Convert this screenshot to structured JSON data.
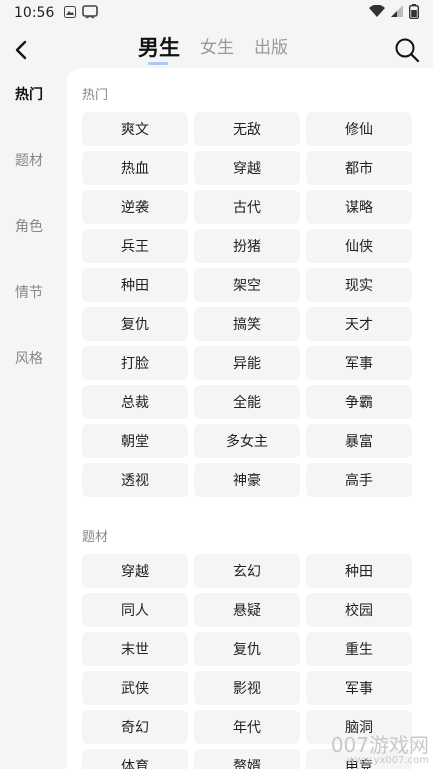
{
  "status_bar": {
    "time": "10:56",
    "notification_icons": [
      "image-icon",
      "app-notification-icon"
    ]
  },
  "header": {
    "tabs": [
      {
        "label": "男生",
        "active": true
      },
      {
        "label": "女生",
        "active": false
      },
      {
        "label": "出版",
        "active": false
      }
    ]
  },
  "sidebar": {
    "items": [
      {
        "label": "热门",
        "active": true
      },
      {
        "label": "题材",
        "active": false
      },
      {
        "label": "角色",
        "active": false
      },
      {
        "label": "情节",
        "active": false
      },
      {
        "label": "风格",
        "active": false
      }
    ]
  },
  "sections": [
    {
      "title": "热门",
      "tags": [
        "爽文",
        "无敌",
        "修仙",
        "热血",
        "穿越",
        "都市",
        "逆袭",
        "古代",
        "谋略",
        "兵王",
        "扮猪",
        "仙侠",
        "种田",
        "架空",
        "现实",
        "复仇",
        "搞笑",
        "天才",
        "打脸",
        "异能",
        "军事",
        "总裁",
        "全能",
        "争霸",
        "朝堂",
        "多女主",
        "暴富",
        "透视",
        "神豪",
        "高手"
      ]
    },
    {
      "title": "题材",
      "tags": [
        "穿越",
        "玄幻",
        "种田",
        "同人",
        "悬疑",
        "校园",
        "末世",
        "复仇",
        "重生",
        "武侠",
        "影视",
        "军事",
        "奇幻",
        "年代",
        "脑洞",
        "体育",
        "赘婿",
        "电竞"
      ]
    }
  ],
  "watermark": {
    "main": "007游戏网",
    "sub": "www.yx007.com"
  },
  "colors": {
    "accent_underline": "#a9c9f5",
    "page_bg": "#f4f5f7",
    "chip_bg": "#f4f5f7"
  }
}
